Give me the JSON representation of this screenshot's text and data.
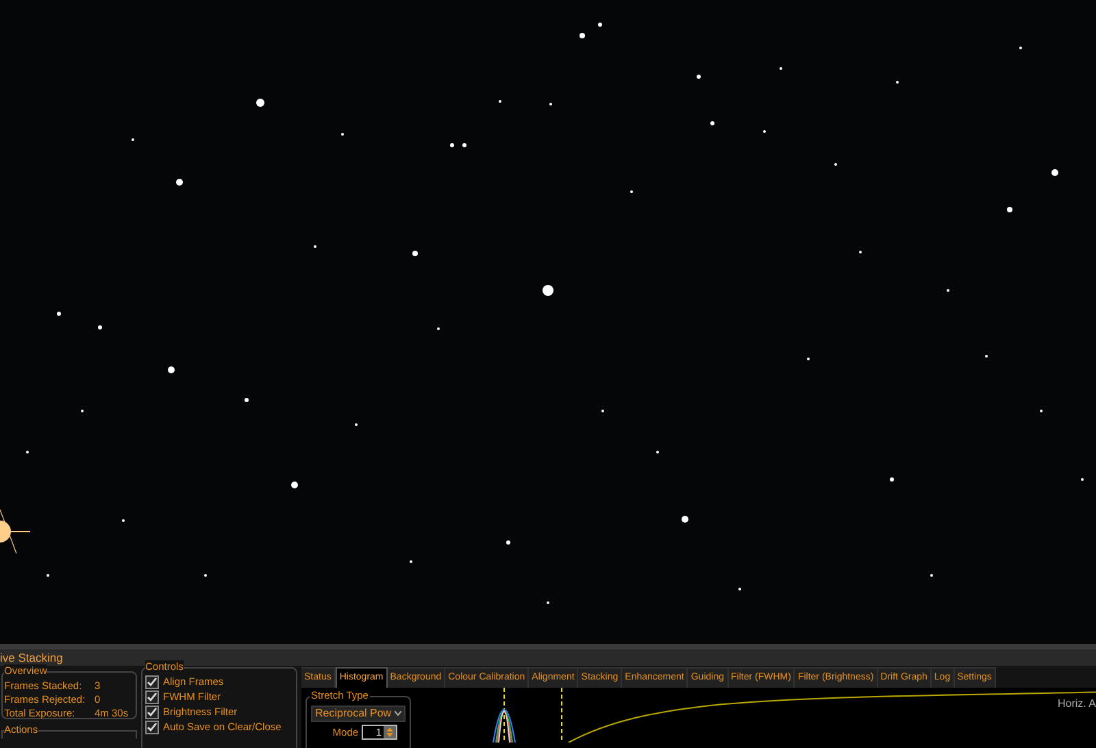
{
  "panel": {
    "title": "ive Stacking"
  },
  "overview": {
    "title": "Overview",
    "rows": [
      {
        "label": "Frames Stacked:",
        "value": "3"
      },
      {
        "label": "Frames Rejected:",
        "value": "0"
      },
      {
        "label": "Total Exposure:",
        "value": "4m 30s"
      }
    ]
  },
  "actions": {
    "title": "Actions"
  },
  "controls": {
    "title": "Controls",
    "items": [
      {
        "label": "Align Frames",
        "checked": true
      },
      {
        "label": "FWHM Filter",
        "checked": true
      },
      {
        "label": "Brightness Filter",
        "checked": true
      },
      {
        "label": "Auto Save on Clear/Close",
        "checked": true
      }
    ]
  },
  "tabs": [
    {
      "label": "Status",
      "selected": false
    },
    {
      "label": "Histogram",
      "selected": true
    },
    {
      "label": "Background",
      "selected": false
    },
    {
      "label": "Colour Calibration",
      "selected": false
    },
    {
      "label": "Alignment",
      "selected": false
    },
    {
      "label": "Stacking",
      "selected": false
    },
    {
      "label": "Enhancement",
      "selected": false
    },
    {
      "label": "Guiding",
      "selected": false
    },
    {
      "label": "Filter (FWHM)",
      "selected": false
    },
    {
      "label": "Filter (Brightness)",
      "selected": false
    },
    {
      "label": "Drift Graph",
      "selected": false
    },
    {
      "label": "Log",
      "selected": false
    },
    {
      "label": "Settings",
      "selected": false
    }
  ],
  "histogram": {
    "stretch_type": {
      "title": "Stretch Type",
      "value": "Reciprocal Pow",
      "mode_label": "Mode",
      "mode_value": "1"
    },
    "axis_label": "Horiz. A"
  }
}
